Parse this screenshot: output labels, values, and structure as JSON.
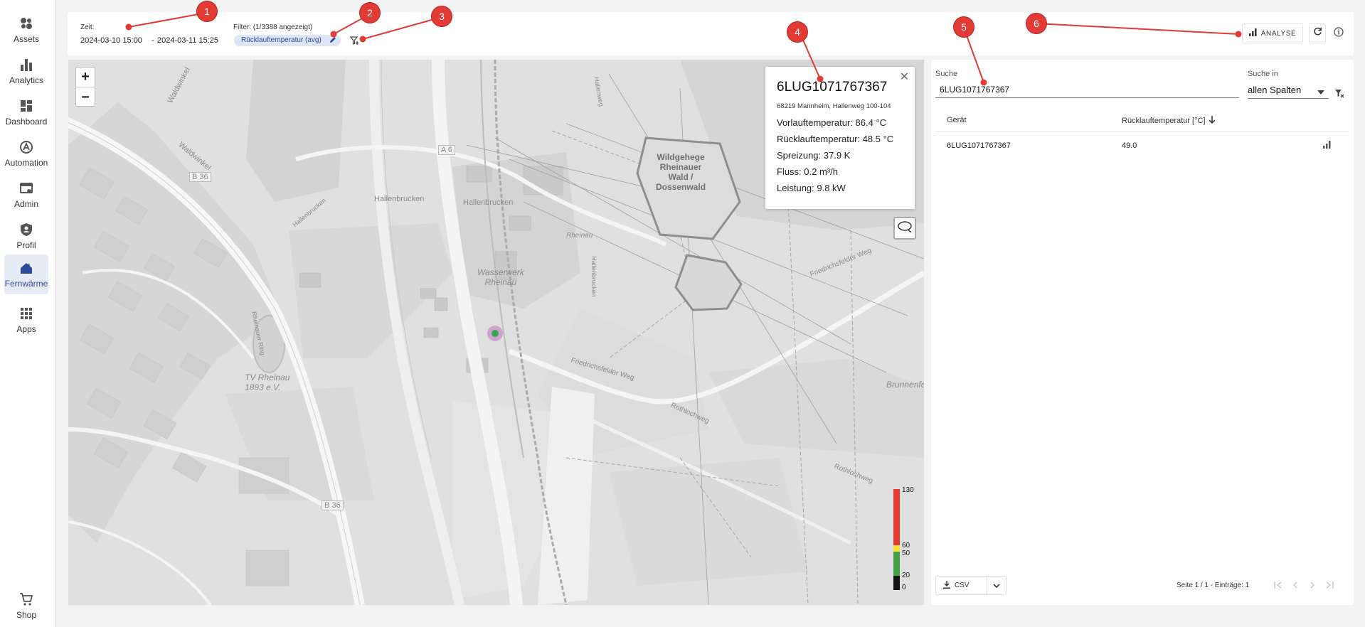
{
  "sidebar": {
    "items": [
      {
        "label": "Assets",
        "icon": "assets-icon"
      },
      {
        "label": "Analytics",
        "icon": "bar-chart-icon"
      },
      {
        "label": "Dashboard",
        "icon": "dashboard-icon"
      },
      {
        "label": "Automation",
        "icon": "automation-icon"
      },
      {
        "label": "Admin",
        "icon": "admin-icon"
      },
      {
        "label": "Profil",
        "icon": "profile-shield-icon"
      },
      {
        "label": "Fernwärme",
        "icon": "district-heating-icon"
      },
      {
        "label": "Apps",
        "icon": "apps-grid-icon"
      }
    ],
    "shop": {
      "label": "Shop",
      "icon": "cart-icon"
    }
  },
  "topbar": {
    "time_label": "Zeit:",
    "time_from": "2024-03-10 15:00",
    "time_sep": "-",
    "time_to": "2024-03-11 15:25",
    "filter_label": "Filter: (1/3388 angezeigt)",
    "filter_chip": "Rücklauftemperatur (avg)",
    "analyse_label": "ANALYSE"
  },
  "map": {
    "labels": {
      "waldwinkel1": "Waldwinkel",
      "waldwinkel2": "Waldwinkel",
      "b36_1": "B 36",
      "b36_2": "B 36",
      "a6": "A 6",
      "hallenbrucken1": "Hallenbrucken",
      "hallenbrucken2": "Hallenbrucken",
      "hallenbrucken3": "Hallenbrucken",
      "hallenbrucken4": "Hallenbrucken",
      "wasserwerk": "Wasserwerk\nRheinau",
      "tv_rheinau": "TV Rheinau\n1893 e.V.",
      "rheinauer_ring": "Rheinauer Ring",
      "friedrichsfelder1": "Friedrichsfelder Weg",
      "friedrichsfelder2": "Friedrichsfelder Weg",
      "rothlochweg1": "Rothlochweg",
      "rothlochweg2": "Rothlochweg",
      "brunnenfeld": "Brunnenfeld",
      "wildgehege": "Wildgehege\nRheinauer\nWald /\nDossenwald",
      "rheinau": "Rheinau",
      "hallenweg": "Hallenweg"
    },
    "popup": {
      "title": "6LUG1071767367",
      "address": "68219 Mannheim, Hallenweg 100-104",
      "lines": [
        "Vorlauftemperatur: 86.4 °C",
        "Rücklauftemperatur: 48.5 °C",
        "Spreizung: 37.9 K",
        "Fluss: 0.2 m³/h",
        "Leistung: 9.8 kW"
      ]
    },
    "legend": {
      "labels": [
        "130",
        "60",
        "50",
        "20",
        "0"
      ],
      "colors": [
        "#e53935",
        "#f5e23a",
        "#43a047",
        "#111111"
      ]
    },
    "zoom_in": "+",
    "zoom_out": "−"
  },
  "panel": {
    "search_label": "Suche",
    "search_value": "6LUG1071767367",
    "search_in_label": "Suche in",
    "search_in_value": "allen Spalten",
    "columns": [
      "Gerät",
      "Rücklauftemperatur [°C]"
    ],
    "rows": [
      {
        "device": "6LUG1071767367",
        "value": "49.0"
      }
    ],
    "csv_label": "CSV",
    "page_info": "Seite 1 / 1 - Einträge: 1"
  },
  "annotations": [
    "1",
    "2",
    "3",
    "4",
    "5",
    "6"
  ]
}
